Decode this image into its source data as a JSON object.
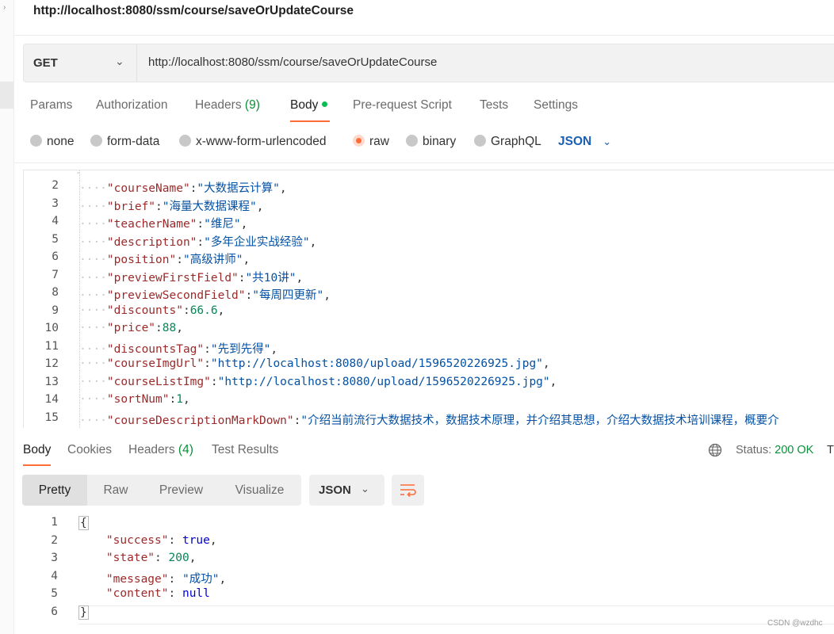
{
  "request_title": "http://localhost:8080/ssm/course/saveOrUpdateCourse",
  "request": {
    "method": "GET",
    "url": "http://localhost:8080/ssm/course/saveOrUpdateCourse"
  },
  "request_tabs": {
    "params": "Params",
    "authorization": "Authorization",
    "headers": "Headers",
    "headers_count": "(9)",
    "body": "Body",
    "prerequest": "Pre-request Script",
    "tests": "Tests",
    "settings": "Settings"
  },
  "body_types": {
    "none": "none",
    "form_data": "form-data",
    "urlencoded": "x-www-form-urlencoded",
    "raw": "raw",
    "binary": "binary",
    "graphql": "GraphQL",
    "selected": "raw",
    "format": "JSON"
  },
  "request_body_lines": [
    {
      "n": "2",
      "key": "\"courseName\"",
      "val": "\"大数据云计算\"",
      "vtype": "s",
      "tail": ","
    },
    {
      "n": "3",
      "key": "\"brief\"",
      "val": "\"海量大数据课程\"",
      "vtype": "s",
      "tail": ","
    },
    {
      "n": "4",
      "key": "\"teacherName\"",
      "val": "\"维尼\"",
      "vtype": "s",
      "tail": ","
    },
    {
      "n": "5",
      "key": "\"description\"",
      "val": "\"多年企业实战经验\"",
      "vtype": "s",
      "tail": ","
    },
    {
      "n": "6",
      "key": "\"position\"",
      "val": "\"高级讲师\"",
      "vtype": "s",
      "tail": ","
    },
    {
      "n": "7",
      "key": "\"previewFirstField\"",
      "val": "\"共10讲\"",
      "vtype": "s",
      "tail": ","
    },
    {
      "n": "8",
      "key": "\"previewSecondField\"",
      "val": "\"每周四更新\"",
      "vtype": "s",
      "tail": ","
    },
    {
      "n": "9",
      "key": "\"discounts\"",
      "val": "66.6",
      "vtype": "n",
      "tail": ","
    },
    {
      "n": "10",
      "key": "\"price\"",
      "val": "88",
      "vtype": "n",
      "tail": ","
    },
    {
      "n": "11",
      "key": "\"discountsTag\"",
      "val": "\"先到先得\"",
      "vtype": "s",
      "tail": ","
    },
    {
      "n": "12",
      "key": "\"courseImgUrl\"",
      "val": "\"http://localhost:8080/upload/1596520226925.jpg\"",
      "vtype": "s",
      "tail": ","
    },
    {
      "n": "13",
      "key": "\"courseListImg\"",
      "val": "\"http://localhost:8080/upload/1596520226925.jpg\"",
      "vtype": "s",
      "tail": ","
    },
    {
      "n": "14",
      "key": "\"sortNum\"",
      "val": "1",
      "vtype": "n",
      "tail": ","
    },
    {
      "n": "15",
      "key": "\"courseDescriptionMarkDown\"",
      "val": "\"介绍当前流行大数据技术，数据技术原理，并介绍其思想，介绍大数据技术培训课程，概要介",
      "vtype": "s",
      "tail": ""
    }
  ],
  "response_tabs": {
    "body": "Body",
    "cookies": "Cookies",
    "headers": "Headers",
    "headers_count": "(4)",
    "test_results": "Test Results"
  },
  "status": {
    "label": "Status:",
    "value": "200 OK",
    "truncated": "T"
  },
  "view_tabs": {
    "pretty": "Pretty",
    "raw": "Raw",
    "preview": "Preview",
    "visualize": "Visualize",
    "format": "JSON"
  },
  "response_lines": [
    {
      "n": "1",
      "text": "{"
    },
    {
      "n": "2",
      "key": "\"success\"",
      "val": "true",
      "tail": ","
    },
    {
      "n": "3",
      "key": "\"state\"",
      "val": "200",
      "tail": ","
    },
    {
      "n": "4",
      "key": "\"message\"",
      "val": "\"成功\"",
      "tail": ","
    },
    {
      "n": "5",
      "key": "\"content\"",
      "val": "null",
      "tail": ""
    },
    {
      "n": "6",
      "text": "}"
    }
  ],
  "watermark": "CSDN @wzdhc",
  "colors": {
    "accent": "#ff6c37",
    "ok_green": "#0a8f3a",
    "json_blue": "#1a5fb4"
  }
}
